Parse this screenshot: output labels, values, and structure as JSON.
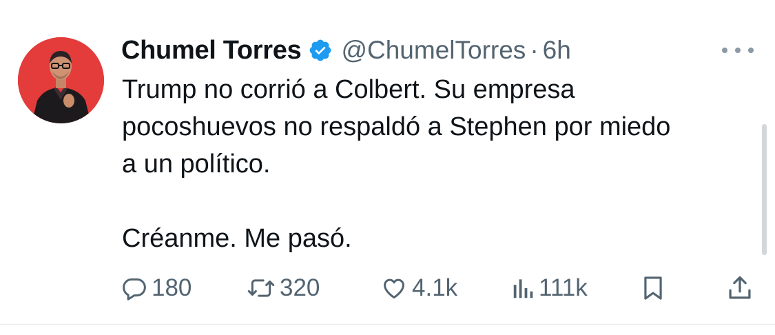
{
  "tweet": {
    "author_name": "Chumel Torres",
    "handle": "@ChumelTorres",
    "separator": "·",
    "time": "6h",
    "body_lines": [
      "Trump no corrió a Colbert. Su empresa",
      "pocoshuevos no respaldó a Stephen por miedo",
      "a un político.",
      "Créanme. Me pasó."
    ],
    "actions": {
      "replies": "180",
      "reposts": "320",
      "likes": "4.1k",
      "views": "111k"
    }
  },
  "colors": {
    "verified_badge": "#1d9bf0",
    "secondary_text": "#536471",
    "avatar_background": "#e43b3b"
  },
  "icons": {
    "verified": "verified-badge-icon",
    "more": "more-dots-icon",
    "reply": "reply-bubble-icon",
    "repost": "repost-arrows-icon",
    "like": "heart-icon",
    "views": "views-bars-icon",
    "bookmark": "bookmark-icon",
    "share": "share-upload-icon"
  }
}
